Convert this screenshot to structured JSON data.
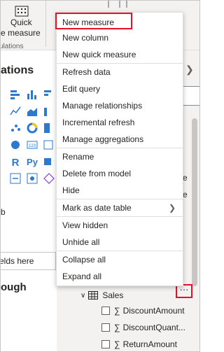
{
  "ribbon": {
    "quick_measure_line1": "Quick",
    "quick_measure_line2": "e measure",
    "group_label": "ulations"
  },
  "left_pane": {
    "title": "ations",
    "field_placeholder": "elds here",
    "drill_title": "ough",
    "frag_b": "b"
  },
  "context_menu": {
    "items": [
      {
        "label": "New measure"
      },
      {
        "label": "New column"
      },
      {
        "label": "New quick measure"
      },
      {
        "label": "Refresh data"
      },
      {
        "label": "Edit query"
      },
      {
        "label": "Manage relationships"
      },
      {
        "label": "Incremental refresh"
      },
      {
        "label": "Manage aggregations"
      },
      {
        "label": "Rename"
      },
      {
        "label": "Delete from model"
      },
      {
        "label": "Hide"
      },
      {
        "label": "Mark as date table"
      },
      {
        "label": "View hidden"
      },
      {
        "label": "Unhide all"
      },
      {
        "label": "Collapse all"
      },
      {
        "label": "Expand all"
      }
    ]
  },
  "fields_pane": {
    "table_name": "Sales",
    "more_label": "···",
    "fields": [
      {
        "label": "DiscountAmount"
      },
      {
        "label": "DiscountQuant..."
      },
      {
        "label": "ReturnAmount"
      }
    ]
  },
  "colors": {
    "highlight": "#e81123",
    "accent_blue": "#2b79d0",
    "visual_yellow": "#f2c811"
  }
}
